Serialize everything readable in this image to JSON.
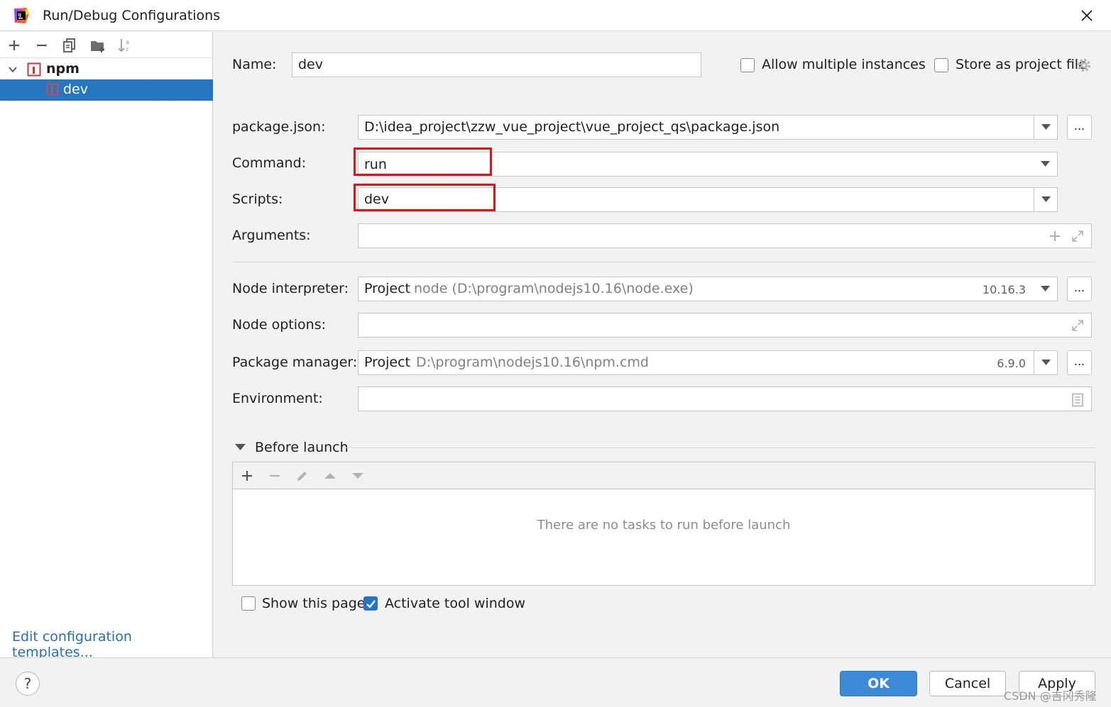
{
  "window": {
    "title": "Run/Debug Configurations"
  },
  "tree": {
    "group_label": "npm",
    "selected_item": "dev"
  },
  "left_footer": {
    "edit_templates": "Edit configuration templates..."
  },
  "form": {
    "name_label": "Name:",
    "name_value": "dev",
    "allow_multiple_label": "Allow multiple instances",
    "store_project_label": "Store as project file",
    "package_json_label": "package.json:",
    "package_json_value": "D:\\idea_project\\zzw_vue_project\\vue_project_qs\\package.json",
    "command_label": "Command:",
    "command_value": "run",
    "scripts_label": "Scripts:",
    "scripts_value": "dev",
    "arguments_label": "Arguments:",
    "node_interpreter_label": "Node interpreter:",
    "node_interpreter_scope": "Project",
    "node_interpreter_path": "node (D:\\program\\nodejs10.16\\node.exe)",
    "node_interpreter_version": "10.16.3",
    "node_options_label": "Node options:",
    "package_manager_label": "Package manager:",
    "package_manager_scope": "Project",
    "package_manager_path": "D:\\program\\nodejs10.16\\npm.cmd",
    "package_manager_version": "6.9.0",
    "environment_label": "Environment:",
    "dots": "..."
  },
  "before_launch": {
    "title": "Before launch",
    "empty_text": "There are no tasks to run before launch",
    "show_page_label": "Show this page",
    "activate_tool_label": "Activate tool window"
  },
  "checkbox_state": {
    "allow_multiple": false,
    "store_project": false,
    "show_page": false,
    "activate_tool": true
  },
  "buttons": {
    "help": "?",
    "ok": "OK",
    "cancel": "Cancel",
    "apply": "Apply"
  },
  "watermark": "CSDN @吉冈秀隆",
  "colors": {
    "selection": "#2675bf",
    "ok_button": "#3c8ad8",
    "highlight_box": "#e0121a",
    "link": "#2470b3"
  }
}
